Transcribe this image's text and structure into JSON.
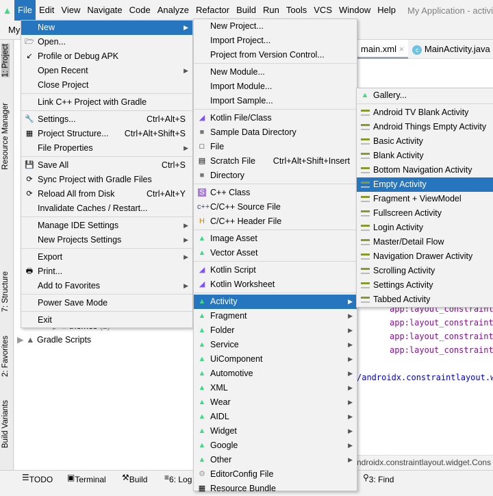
{
  "menubar": {
    "items": [
      "File",
      "Edit",
      "View",
      "Navigate",
      "Code",
      "Analyze",
      "Refactor",
      "Build",
      "Run",
      "Tools",
      "VCS",
      "Window",
      "Help"
    ],
    "active": "File",
    "window_title": "My Application - activi"
  },
  "toolbar": {
    "project": "My"
  },
  "left_stripe": {
    "project": "1: Project",
    "resource_manager": "Resource Manager",
    "structure": "7: Structure",
    "favorites": "2: Favorites",
    "build_variants": "Build Variants"
  },
  "tree": {
    "themes": "themes",
    "themes_count": "(2)",
    "gradle": "Gradle Scripts"
  },
  "editor": {
    "tabs": [
      {
        "label": "main.xml",
        "current": true
      },
      {
        "label": "MainActivity.java"
      }
    ],
    "code": [
      "app:layout_constraintE",
      "app:layout_constraintE",
      "app:layout_constraintS",
      "app:layout_constraintT",
      "/androidx.constraintlayout.wi"
    ],
    "breadcrumb": "ndroidx.constraintlayout.widget.Cons"
  },
  "bottom": {
    "todo": "TODO",
    "terminal": "Terminal",
    "build": "Build",
    "logcat": "6: Log",
    "find": "3: Find"
  },
  "file_menu": [
    {
      "label": "New",
      "submenu": true,
      "highlighted": true
    },
    {
      "label": "Open...",
      "icon": "folder-open-icon"
    },
    {
      "label": "Profile or Debug APK",
      "icon": "profile-apk-icon"
    },
    {
      "label": "Open Recent",
      "submenu": true
    },
    {
      "label": "Close Project",
      "sep_after": true
    },
    {
      "label": "Link C++ Project with Gradle",
      "sep_after": true
    },
    {
      "label": "Settings...",
      "icon": "wrench-icon",
      "shortcut": "Ctrl+Alt+S"
    },
    {
      "label": "Project Structure...",
      "icon": "project-structure-icon",
      "shortcut": "Ctrl+Alt+Shift+S"
    },
    {
      "label": "File Properties",
      "submenu": true,
      "sep_after": true
    },
    {
      "label": "Save All",
      "icon": "save-icon",
      "shortcut": "Ctrl+S"
    },
    {
      "label": "Sync Project with Gradle Files",
      "icon": "gradle-sync-icon"
    },
    {
      "label": "Reload All from Disk",
      "icon": "reload-icon",
      "shortcut": "Ctrl+Alt+Y"
    },
    {
      "label": "Invalidate Caches / Restart...",
      "sep_after": true
    },
    {
      "label": "Manage IDE Settings",
      "submenu": true
    },
    {
      "label": "New Projects Settings",
      "submenu": true,
      "sep_after": true
    },
    {
      "label": "Export",
      "submenu": true
    },
    {
      "label": "Print...",
      "icon": "print-icon"
    },
    {
      "label": "Add to Favorites",
      "submenu": true,
      "sep_after": true
    },
    {
      "label": "Power Save Mode",
      "sep_after": true
    },
    {
      "label": "Exit"
    }
  ],
  "new_menu": [
    {
      "label": "New Project..."
    },
    {
      "label": "Import Project..."
    },
    {
      "label": "Project from Version Control...",
      "sep_after": true
    },
    {
      "label": "New Module..."
    },
    {
      "label": "Import Module..."
    },
    {
      "label": "Import Sample...",
      "sep_after": true
    },
    {
      "label": "Kotlin File/Class",
      "icon": "kotlin-icon"
    },
    {
      "label": "Sample Data Directory",
      "icon": "folder-icon"
    },
    {
      "label": "File",
      "icon": "file-icon"
    },
    {
      "label": "Scratch File",
      "icon": "scratch-file-icon",
      "shortcut": "Ctrl+Alt+Shift+Insert"
    },
    {
      "label": "Directory",
      "icon": "folder-icon",
      "sep_after": true
    },
    {
      "label": "C++ Class",
      "icon": "cpp-class-icon"
    },
    {
      "label": "C/C++ Source File",
      "icon": "cpp-source-icon"
    },
    {
      "label": "C/C++ Header File",
      "icon": "cpp-header-icon",
      "sep_after": true
    },
    {
      "label": "Image Asset",
      "icon": "android-icon"
    },
    {
      "label": "Vector Asset",
      "icon": "android-icon",
      "sep_after": true
    },
    {
      "label": "Kotlin Script",
      "icon": "kotlin-script-icon"
    },
    {
      "label": "Kotlin Worksheet",
      "icon": "kotlin-worksheet-icon",
      "sep_after": true
    },
    {
      "label": "Activity",
      "icon": "android-icon",
      "submenu": true,
      "highlighted": true
    },
    {
      "label": "Fragment",
      "icon": "android-icon",
      "submenu": true
    },
    {
      "label": "Folder",
      "icon": "android-icon",
      "submenu": true
    },
    {
      "label": "Service",
      "icon": "android-icon",
      "submenu": true
    },
    {
      "label": "UiComponent",
      "icon": "android-icon",
      "submenu": true
    },
    {
      "label": "Automotive",
      "icon": "android-icon",
      "submenu": true
    },
    {
      "label": "XML",
      "icon": "android-icon",
      "submenu": true
    },
    {
      "label": "Wear",
      "icon": "android-icon",
      "submenu": true
    },
    {
      "label": "AIDL",
      "icon": "android-icon",
      "submenu": true
    },
    {
      "label": "Widget",
      "icon": "android-icon",
      "submenu": true
    },
    {
      "label": "Google",
      "icon": "android-icon",
      "submenu": true
    },
    {
      "label": "Other",
      "icon": "android-icon",
      "submenu": true
    },
    {
      "label": "EditorConfig File",
      "icon": "gear-icon"
    },
    {
      "label": "Resource Bundle",
      "icon": "resource-bundle-icon"
    }
  ],
  "activity_menu": [
    {
      "label": "Gallery...",
      "icon": "android-icon",
      "sep_after": true
    },
    {
      "label": "Android TV Blank Activity"
    },
    {
      "label": "Android Things Empty Activity"
    },
    {
      "label": "Basic Activity"
    },
    {
      "label": "Blank Activity"
    },
    {
      "label": "Bottom Navigation Activity"
    },
    {
      "label": "Empty Activity",
      "highlighted": true
    },
    {
      "label": "Fragment + ViewModel"
    },
    {
      "label": "Fullscreen Activity"
    },
    {
      "label": "Login Activity"
    },
    {
      "label": "Master/Detail Flow"
    },
    {
      "label": "Navigation Drawer Activity"
    },
    {
      "label": "Scrolling Activity"
    },
    {
      "label": "Settings Activity"
    },
    {
      "label": "Tabbed Activity"
    }
  ],
  "colors": {
    "highlight": "#2675bf",
    "android_green": "#3ddc84",
    "menu_bg": "#f2f2f2"
  }
}
